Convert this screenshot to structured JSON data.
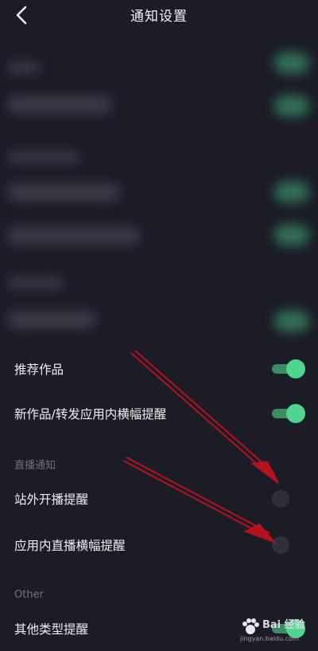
{
  "header": {
    "title": "通知设置"
  },
  "sections": [
    {
      "items": [
        {
          "label": "推荐作品",
          "on": true
        },
        {
          "label": "新作品/转发应用内横幅提醒",
          "on": true
        }
      ]
    },
    {
      "title": "直播通知",
      "items": [
        {
          "label": "站外开播提醒",
          "on": false
        },
        {
          "label": "应用内直播横幅提醒",
          "on": false
        }
      ]
    },
    {
      "title": "Other",
      "items": [
        {
          "label": "其他类型提醒",
          "on": true
        }
      ]
    }
  ],
  "colors": {
    "background": "#1b1c26",
    "toggle_on": "#4fd58c",
    "toggle_off": "#2e2f37",
    "arrow": "#b3121e"
  },
  "watermark": {
    "brand": "Bai 经验",
    "url": "jingyan.baidu.com"
  }
}
